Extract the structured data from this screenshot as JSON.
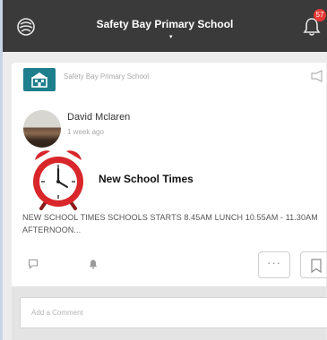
{
  "header": {
    "title": "Safety Bay Primary School",
    "caret": "▾",
    "notification_count": "57"
  },
  "post": {
    "school_name": "Safety Bay Primary School",
    "author": "David Mclaren",
    "time": "1 week ago",
    "title": "New School Times",
    "excerpt": "NEW SCHOOL TIMES SCHOOLS STARTS 8.45AM LUNCH 10.55AM - 11.30AM AFTERNOON...",
    "more_label": "···"
  },
  "comment": {
    "placeholder": "Add a Comment"
  },
  "colors": {
    "topbar": "#3a3a3a",
    "badge": "#e53935",
    "school_logo": "#1e7f8c",
    "clock_red": "#d8262a"
  },
  "icons": [
    "logo-icon",
    "bell-icon",
    "announcement-icon",
    "comment-icon",
    "like-icon",
    "more-icon",
    "bookmark-icon"
  ]
}
